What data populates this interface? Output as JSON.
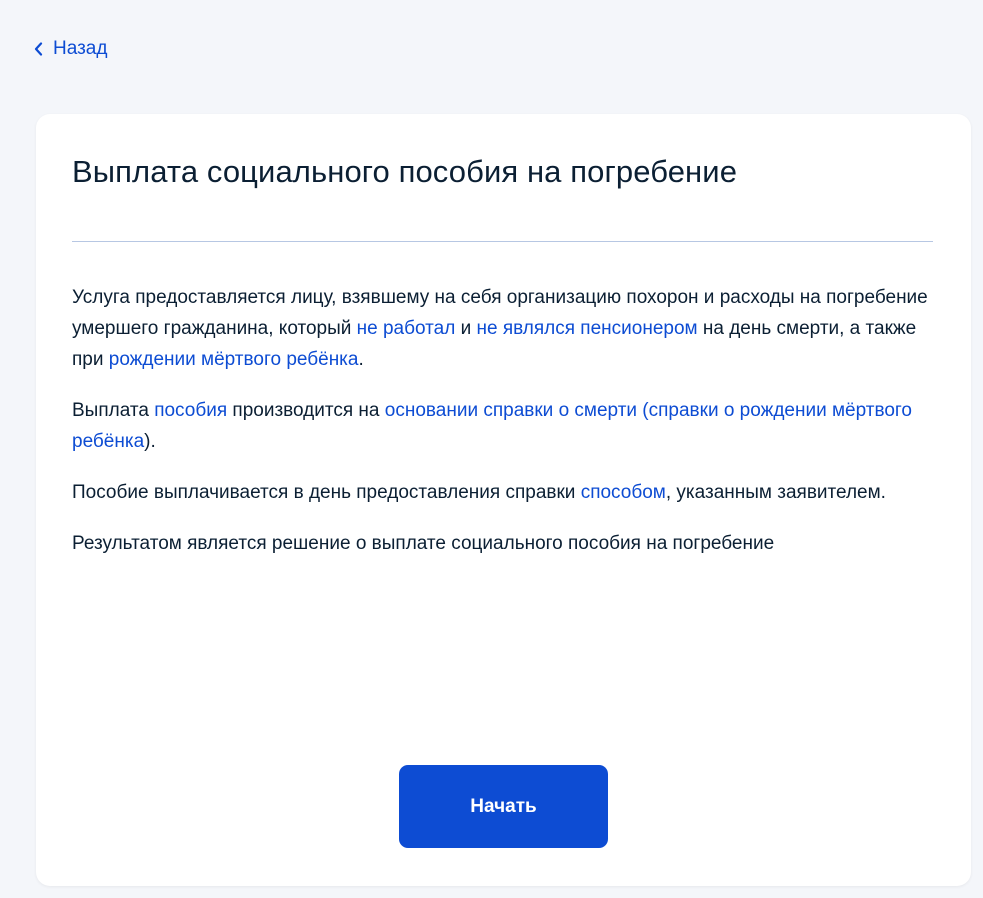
{
  "nav": {
    "back_label": "Назад"
  },
  "card": {
    "title": "Выплата социального пособия на погребение",
    "p1": {
      "t1": "Услуга предоставляется лицу, взявшему на себя организацию похорон и расходы на погребение умершего гражданина, который ",
      "l1": "не работал",
      "t2": " и ",
      "l2": "не являлся пенсионером",
      "t3": " на день смерти, а также при ",
      "l3": "рождении мёртвого ребёнка",
      "t4": "."
    },
    "p2": {
      "t1": "Выплата ",
      "l1": "пособия",
      "t2": " производится на ",
      "l2": "основании справки о смерти (справки о рождении мёртвого ребёнка",
      "t3": ")."
    },
    "p3": {
      "t1": "Пособие выплачивается в день предоставления справки ",
      "l1": "способом",
      "t2": ", указанным заявителем."
    },
    "p4": {
      "t1": "Результатом является решение о выплате социального пособия на погребение"
    },
    "start_label": "Начать"
  },
  "colors": {
    "accent": "#0d4cd3",
    "text": "#0b1f33",
    "background": "#f4f6fa",
    "card": "#ffffff",
    "divider": "#b7c7e3"
  },
  "icons": {
    "back": "chevron-left-icon"
  }
}
